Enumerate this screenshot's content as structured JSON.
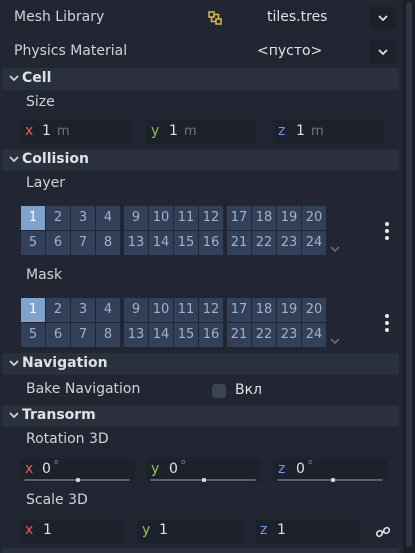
{
  "colors": {
    "background": "#212632",
    "section_header": "#2a303c",
    "field_bg": "#1c212b",
    "axis_x": "#e2614f",
    "axis_y": "#8ec34c",
    "axis_z": "#6e98e8",
    "layer_on": "#7fa3cf",
    "layer_off": "#33405a"
  },
  "mesh_library": {
    "label": "Mesh Library",
    "value": "tiles.tres",
    "icon": "mesh-library-resource-icon"
  },
  "physics_material": {
    "label": "Physics Material",
    "value": "<пусто>"
  },
  "cell": {
    "title": "Cell",
    "size_label": "Size",
    "x": {
      "axis": "x",
      "value": "1",
      "unit": "m"
    },
    "y": {
      "axis": "y",
      "value": "1",
      "unit": "m"
    },
    "z": {
      "axis": "z",
      "value": "1",
      "unit": "m"
    }
  },
  "collision": {
    "title": "Collision",
    "layer_label": "Layer",
    "layer_enabled": [
      1
    ],
    "mask_label": "Mask",
    "mask_enabled": [
      1
    ],
    "grid_numbers": [
      "1",
      "2",
      "3",
      "4",
      "9",
      "10",
      "11",
      "12",
      "17",
      "18",
      "19",
      "20",
      "5",
      "6",
      "7",
      "8",
      "13",
      "14",
      "15",
      "16",
      "21",
      "22",
      "23",
      "24"
    ]
  },
  "navigation": {
    "title": "Navigation",
    "bake_label": "Bake Navigation",
    "bake_checked": false,
    "bake_value": "Вкл"
  },
  "transform": {
    "title": "Transorm",
    "rotation_label": "Rotation 3D",
    "rotation": {
      "x": {
        "axis": "x",
        "value": "0",
        "unit": "°",
        "slider": 0.5
      },
      "y": {
        "axis": "y",
        "value": "0",
        "unit": "°",
        "slider": 0.5
      },
      "z": {
        "axis": "z",
        "value": "0",
        "unit": "°",
        "slider": 0.5
      }
    },
    "scale_label": "Scale 3D",
    "scale": {
      "x": {
        "axis": "x",
        "value": "1"
      },
      "y": {
        "axis": "y",
        "value": "1"
      },
      "z": {
        "axis": "z",
        "value": "1"
      }
    },
    "link_icon": "link-icon"
  }
}
